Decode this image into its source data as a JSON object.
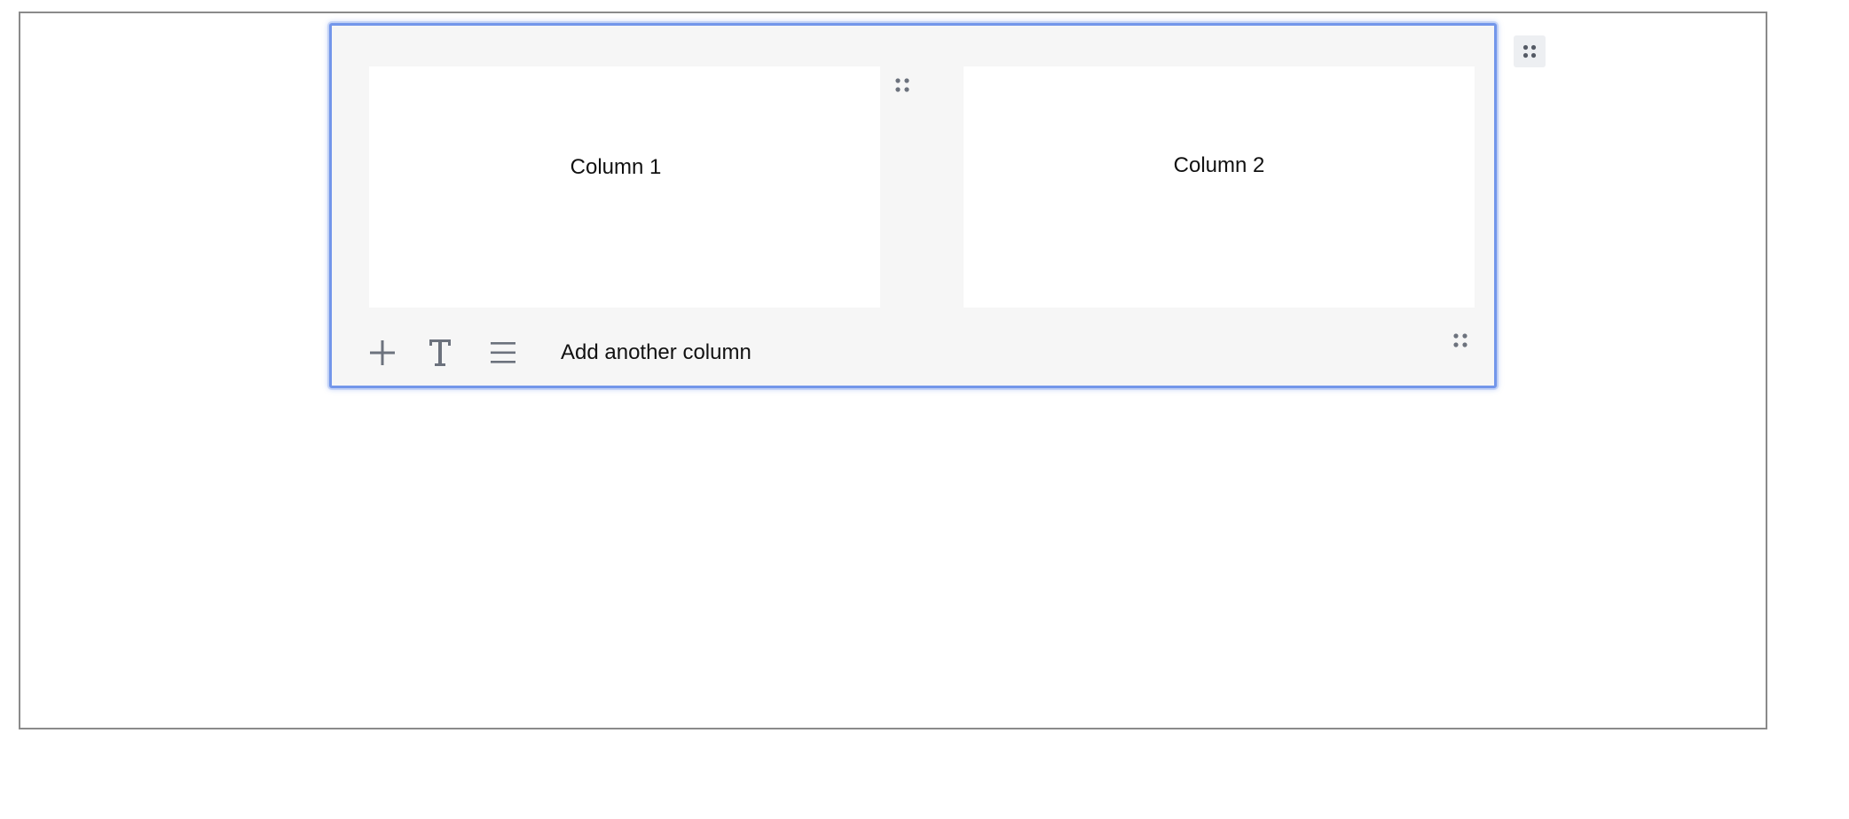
{
  "layout_block": {
    "columns": [
      {
        "label": "Column 1"
      },
      {
        "label": "Column 2"
      }
    ],
    "toolbar": {
      "add_icon": "plus-icon",
      "text_icon": "text-format-icon",
      "align_icon": "align-justify-icon",
      "add_column_label": "Add another column"
    },
    "drag_icon": "drag-handle-icon"
  },
  "colors": {
    "selection_border": "#7396ea",
    "block_background": "#f6f6f6",
    "column_background": "#ffffff",
    "icon": "#6c727d",
    "canvas_border": "#8a8a8a"
  }
}
